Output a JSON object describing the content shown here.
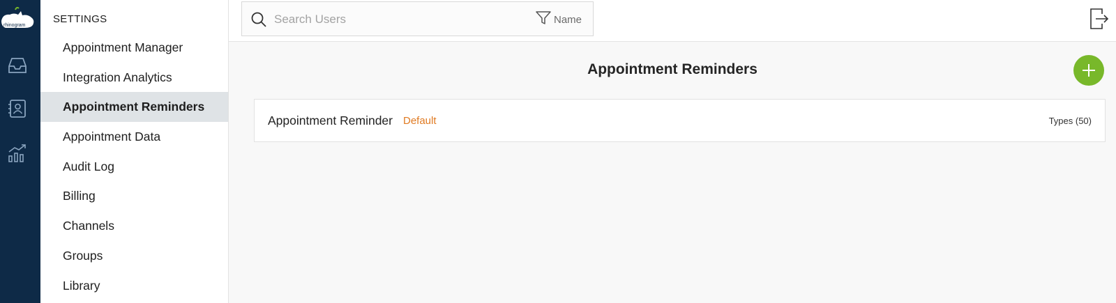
{
  "brand": {
    "logo_text": "rhinogram",
    "accent": "#78b82a",
    "rail_color": "#0e2a47"
  },
  "rail": {
    "icons": [
      "inbox-icon",
      "contacts-icon",
      "analytics-icon"
    ]
  },
  "sidebar": {
    "heading": "SETTINGS",
    "items": [
      {
        "label": "Appointment Manager",
        "active": false
      },
      {
        "label": "Integration Analytics",
        "active": false
      },
      {
        "label": "Appointment Reminders",
        "active": true
      },
      {
        "label": "Appointment Data",
        "active": false
      },
      {
        "label": "Audit Log",
        "active": false
      },
      {
        "label": "Billing",
        "active": false
      },
      {
        "label": "Channels",
        "active": false
      },
      {
        "label": "Groups",
        "active": false
      },
      {
        "label": "Library",
        "active": false
      }
    ]
  },
  "topbar": {
    "search": {
      "placeholder": "Search Users",
      "value": ""
    },
    "filter_label": "Name"
  },
  "main": {
    "title": "Appointment Reminders",
    "reminders": [
      {
        "name": "Appointment Reminder",
        "badge": "Default",
        "types": "Types (50)"
      }
    ]
  }
}
